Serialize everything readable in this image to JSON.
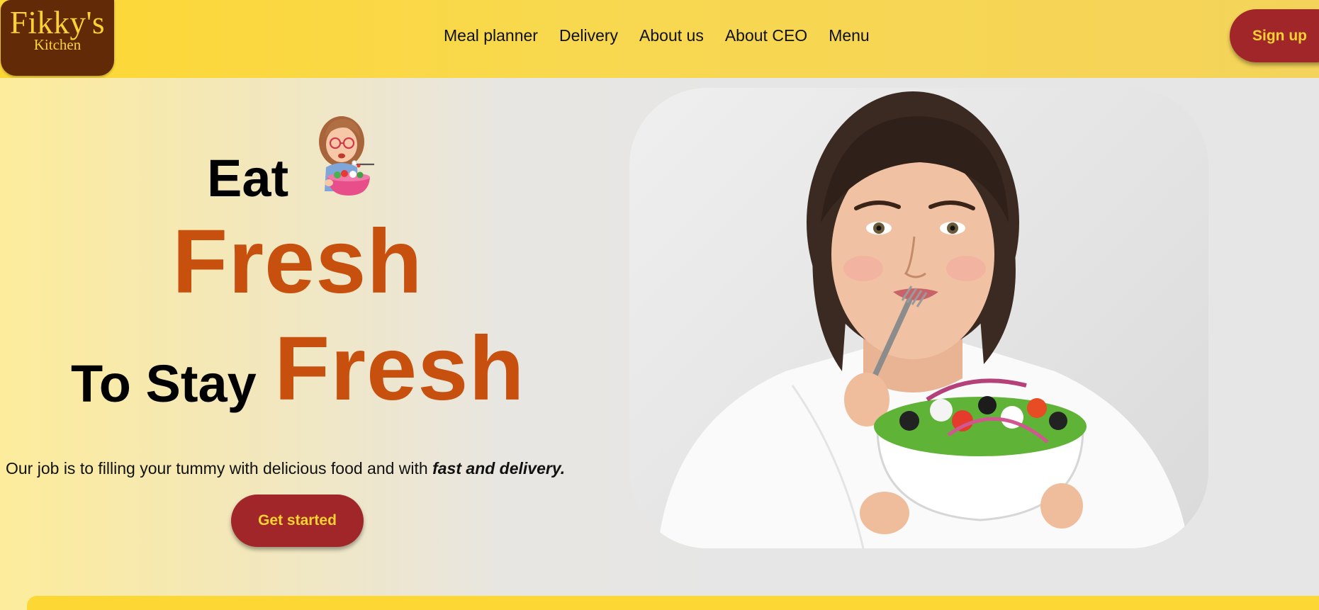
{
  "logo": {
    "main": "Fikky's",
    "sub": "Kitchen"
  },
  "nav": {
    "links": [
      "Meal planner",
      "Delivery",
      "About us",
      "About CEO",
      "Menu"
    ],
    "signup_label": "Sign up"
  },
  "hero": {
    "line1": "Eat",
    "line2": "Fresh",
    "line3_prefix": "To Stay",
    "line3_highlight": "Fresh",
    "tagline_text": "Our job is to filling your tummy with delicious food and with ",
    "tagline_emphasis": "fast and delivery.",
    "cta_label": "Get started"
  },
  "colors": {
    "brand_yellow": "#fdd835",
    "brand_brown": "#632a08",
    "accent_red": "#a1262a",
    "headline_orange": "#c8500f"
  },
  "icons": {
    "avatar": "woman-eating-salad-emoji",
    "hero_image": "woman-eating-salad-photo"
  }
}
